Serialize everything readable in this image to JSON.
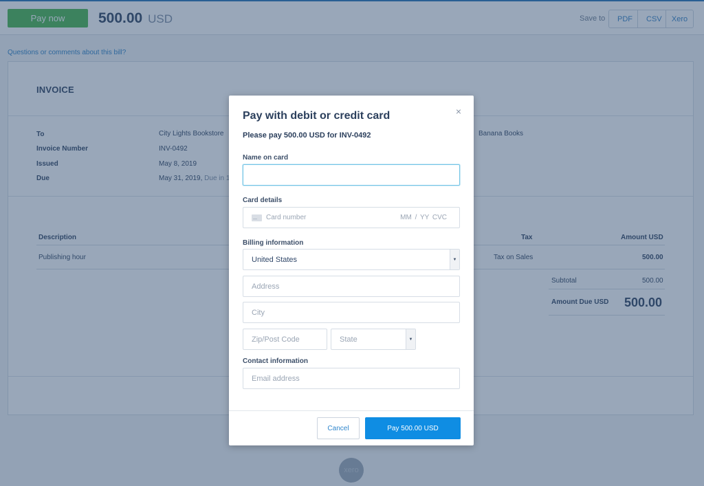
{
  "topbar": {
    "pay_now_label": "Pay now",
    "amount": "500.00",
    "currency": "USD",
    "save_to_label": "Save to",
    "save_options": [
      "PDF",
      "CSV",
      "Xero"
    ]
  },
  "questions_link": "Questions or comments about this bill?",
  "invoice": {
    "title": "INVOICE",
    "meta": [
      {
        "label": "To",
        "value": "City Lights Bookstore"
      },
      {
        "label": "Invoice Number",
        "value": "INV-0492"
      },
      {
        "label": "Issued",
        "value": "May 8, 2019"
      },
      {
        "label": "Due",
        "value": "May 31, 2019,",
        "extra": "Due in 1"
      }
    ],
    "from": "Banana Books",
    "table": {
      "headers": {
        "description": "Description",
        "tax": "Tax",
        "amount": "Amount USD"
      },
      "rows": [
        {
          "description": "Publishing hour",
          "tax": "Tax on Sales",
          "amount": "500.00"
        }
      ]
    },
    "subtotal_label": "Subtotal",
    "subtotal_value": "500.00",
    "amount_due_label": "Amount Due USD",
    "amount_due_value": "500.00"
  },
  "footer": {
    "logo_text": "xero"
  },
  "modal": {
    "title": "Pay with debit or credit card",
    "close_icon": "×",
    "subtitle": "Please pay 500.00 USD for INV-0492",
    "name_label": "Name on card",
    "name_value": "",
    "card_label": "Card details",
    "card_number_placeholder": "Card number",
    "card_exp_placeholder": "MM / YY  CVC",
    "billing_label": "Billing information",
    "country_value": "United States",
    "address_placeholder": "Address",
    "city_placeholder": "City",
    "zip_placeholder": "Zip/Post Code",
    "state_placeholder": "State",
    "contact_label": "Contact information",
    "email_placeholder": "Email address",
    "cancel_label": "Cancel",
    "pay_label": "Pay 500.00 USD",
    "dropdown_arrow": "▼"
  },
  "colors": {
    "pay_now_green": "#44b548",
    "primary_blue": "#0f8de3",
    "link_blue": "#2b80c5",
    "focus_border": "#75c5e6"
  }
}
